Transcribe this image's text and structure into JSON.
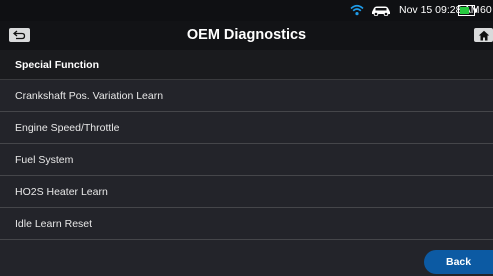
{
  "status_bar": {
    "datetime": "Nov 15  09:28 AM",
    "battery_percent": "60",
    "icons": [
      "wifi-icon",
      "car-icon",
      "battery-icon"
    ]
  },
  "title_bar": {
    "title": "OEM Diagnostics",
    "back_icon": "return-arrow-icon",
    "home_icon": "home-icon"
  },
  "section": {
    "header": "Special Function"
  },
  "functions": [
    "Crankshaft Pos. Variation Learn",
    "Engine Speed/Throttle",
    "Fuel System",
    "HO2S Heater Learn",
    "Idle Learn Reset"
  ],
  "footer": {
    "back_label": "Back"
  },
  "colors": {
    "status_bg": "#0f1013",
    "list_bg": "#23242a",
    "accent_button": "#0c5aa3",
    "battery_fill": "#27c93f",
    "wifi": "#1f9be8"
  }
}
